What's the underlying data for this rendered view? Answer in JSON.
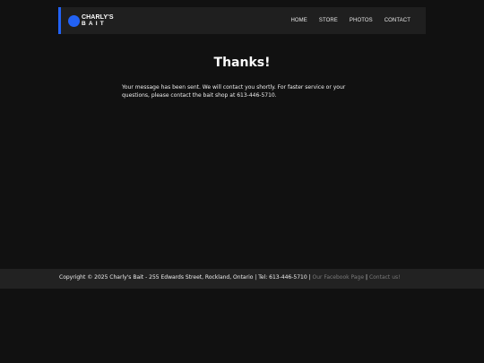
{
  "header": {
    "logo_line1": "CHARLY'S",
    "logo_line2": "BAIT",
    "nav": [
      "HOME",
      "STORE",
      "PHOTOS",
      "CONTACT"
    ]
  },
  "main": {
    "title": "Thanks!",
    "message": "Your message has been sent. We will contact you shortly. For faster service or your questions, please contact the bait shop at 613-446-5710."
  },
  "footer": {
    "copyright": "Copyright © 2025 Charly's Bait - 255 Edwards Street, Rockland, Ontario | Tel: 613-446-5710 |",
    "facebook_link": "Our Facebook Page",
    "separator": "|",
    "contact_link": "Contact us!"
  },
  "colors": {
    "background": "#111111",
    "header_bg": "#1f1f1f",
    "footer_bg": "#222222",
    "accent": "#2262f5",
    "link": "#7a7a7a"
  }
}
